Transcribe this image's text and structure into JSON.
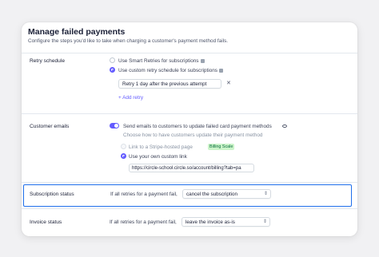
{
  "header": {
    "title": "Manage failed payments",
    "subtitle": "Configure the steps you'd like to take when charging a customer's payment method fails."
  },
  "retry": {
    "label": "Retry schedule",
    "option_smart": "Use Smart Retries for subscriptions",
    "option_custom": "Use custom retry schedule for subscriptions",
    "schedule_value": "Retry 1 day after the previous attempt",
    "add_retry": "+ Add retry"
  },
  "emails": {
    "label": "Customer emails",
    "toggle_label": "Send emails to customers to update failed card payment methods",
    "toggle_hint": "Choose how to have customers update their payment method",
    "option_hosted": "Link to a Stripe-hosted page",
    "hosted_badge": "Billing Scale",
    "option_custom": "Use your own custom link",
    "custom_url": "https://circle-school.circle.so/account/billing?tab=pa"
  },
  "subscription_status": {
    "label": "Subscription status",
    "prefix": "If all retries for a payment fail,",
    "value": "cancel the subscription"
  },
  "invoice_status": {
    "label": "Invoice status",
    "prefix": "If all retries for a payment fail,",
    "value": "leave the invoice as-is"
  },
  "colors": {
    "accent": "#635bff",
    "highlight_border": "#1f6feb",
    "badge_bg": "#cbf4c9"
  },
  "icons": {
    "info": "info-icon",
    "close": "close-icon",
    "preview": "eye-icon",
    "select": "chevron-updown-icon"
  }
}
